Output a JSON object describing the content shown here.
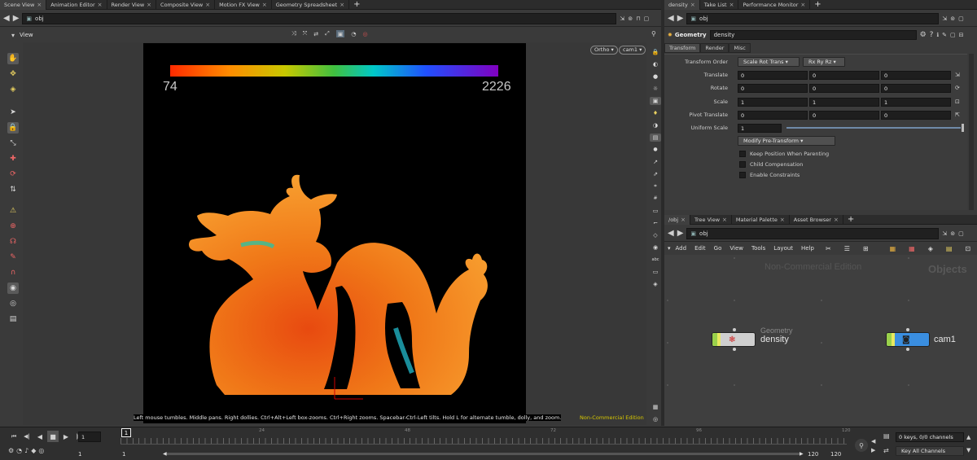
{
  "left_tabs": [
    "Scene View",
    "Animation Editor",
    "Render View",
    "Composite View",
    "Motion FX View",
    "Geometry Spreadsheet"
  ],
  "right_top_tabs": [
    "density",
    "Take List",
    "Performance Monitor"
  ],
  "right_bottom_tabs": [
    "/obj",
    "Tree View",
    "Material Palette",
    "Asset Browser"
  ],
  "viewport": {
    "path": "obj",
    "title": "View",
    "projection": "Ortho",
    "camera": "cam1",
    "colorbar_min": "74",
    "colorbar_max": "2226",
    "hint": "Left mouse tumbles. Middle pans. Right dollies. Ctrl+Alt+Left box-zooms. Ctrl+Right zooms. Spacebar-Ctrl-Left tilts. Hold L for alternate tumble, dolly, and zoom.",
    "watermark": "Non-Commercial Edition"
  },
  "params": {
    "path": "obj",
    "node_type": "Geometry",
    "node_name": "density",
    "subtabs": [
      "Transform",
      "Render",
      "Misc"
    ],
    "transform_order_label": "Transform Order",
    "transform_order": "Scale Rot Trans",
    "rotate_order": "Rx Ry Rz",
    "rows": [
      {
        "label": "Translate",
        "values": [
          "0",
          "0",
          "0"
        ]
      },
      {
        "label": "Rotate",
        "values": [
          "0",
          "0",
          "0"
        ]
      },
      {
        "label": "Scale",
        "values": [
          "1",
          "1",
          "1"
        ]
      },
      {
        "label": "Pivot Translate",
        "values": [
          "0",
          "0",
          "0"
        ]
      }
    ],
    "uniform_scale_label": "Uniform Scale",
    "uniform_scale": "1",
    "modify_pre_transform": "Modify Pre-Transform",
    "checkboxes": [
      "Keep Position When Parenting",
      "Child Compensation",
      "Enable Constraints"
    ]
  },
  "network": {
    "path": "obj",
    "menu": [
      "Add",
      "Edit",
      "Go",
      "View",
      "Tools",
      "Layout",
      "Help"
    ],
    "watermark": "Non-Commercial Edition",
    "context_label": "Objects",
    "node1_type": "Geometry",
    "node1_name": "density",
    "node2_name": "cam1"
  },
  "timeline": {
    "frame": "1",
    "ticks": [
      "1",
      "24",
      "48",
      "72",
      "96",
      "120"
    ],
    "start": "1",
    "start2": "1",
    "end": "120",
    "end2": "120",
    "keys_info": "0 keys, 0/0 channels",
    "key_all": "Key All Channels"
  }
}
